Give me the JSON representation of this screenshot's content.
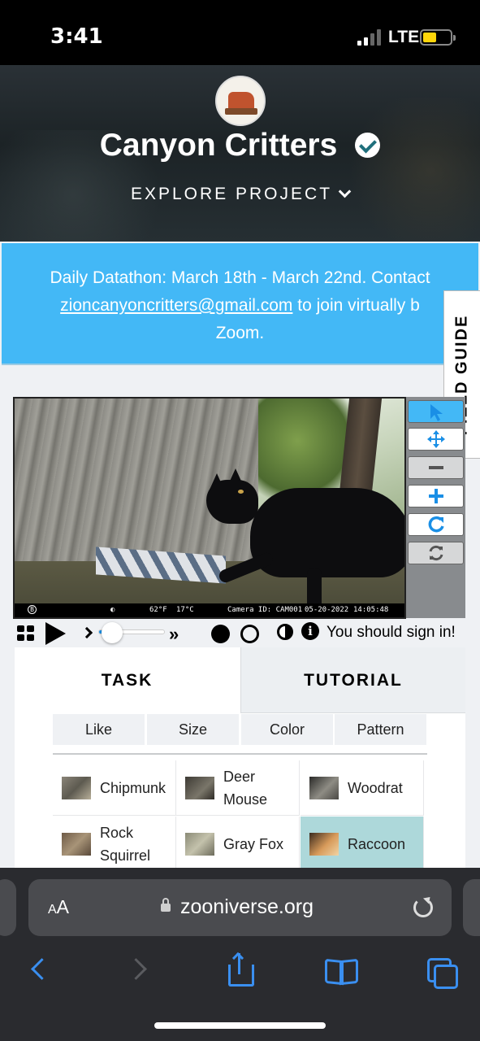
{
  "status_bar": {
    "time": "3:41",
    "network": "LTE"
  },
  "project": {
    "title": "Canyon Critters",
    "explore_label": "EXPLORE PROJECT",
    "logo_text": "CANYON CRITTERS"
  },
  "announcement": {
    "text_before": "Daily Datathon: March 18th - March 22nd. Contact ",
    "email": "zioncanyoncritters@gmail.com",
    "text_after": " to join virtually b",
    "text_line3": "Zoom."
  },
  "field_guide_label": "FIELD GUIDE",
  "subject_image": {
    "temp_f": "62°F",
    "temp_c": "17°C",
    "camera_id": "Camera ID: CAM001",
    "date": "05-20-2022",
    "time": "14:05:48",
    "badge": "B"
  },
  "toolbar": {
    "icons": [
      "pointer-icon",
      "move-icon",
      "zoom-out-icon",
      "zoom-in-icon",
      "rotate-icon",
      "reset-icon"
    ],
    "active": "pointer-icon"
  },
  "player": {
    "signin_text": "You should sign in!",
    "progress": 0.2,
    "accent_color": "#1a8fe6"
  },
  "tabs": {
    "task": "TASK",
    "tutorial": "TUTORIAL"
  },
  "filters": [
    "Like",
    "Size",
    "Color",
    "Pattern"
  ],
  "choices": [
    {
      "label": "Chipmunk",
      "selected": false
    },
    {
      "label": "Deer Mouse",
      "selected": false
    },
    {
      "label": "Woodrat",
      "selected": false
    },
    {
      "label": "Rock Squirrel",
      "selected": false
    },
    {
      "label": "Gray Fox",
      "selected": false
    },
    {
      "label": "Raccoon",
      "selected": true
    }
  ],
  "browser": {
    "aa": "AA",
    "url": "zooniverse.org"
  },
  "colors": {
    "announcement_bg": "#43b8f6",
    "selected_choice": "#add8da",
    "browser_accent": "#3a8ff0"
  }
}
